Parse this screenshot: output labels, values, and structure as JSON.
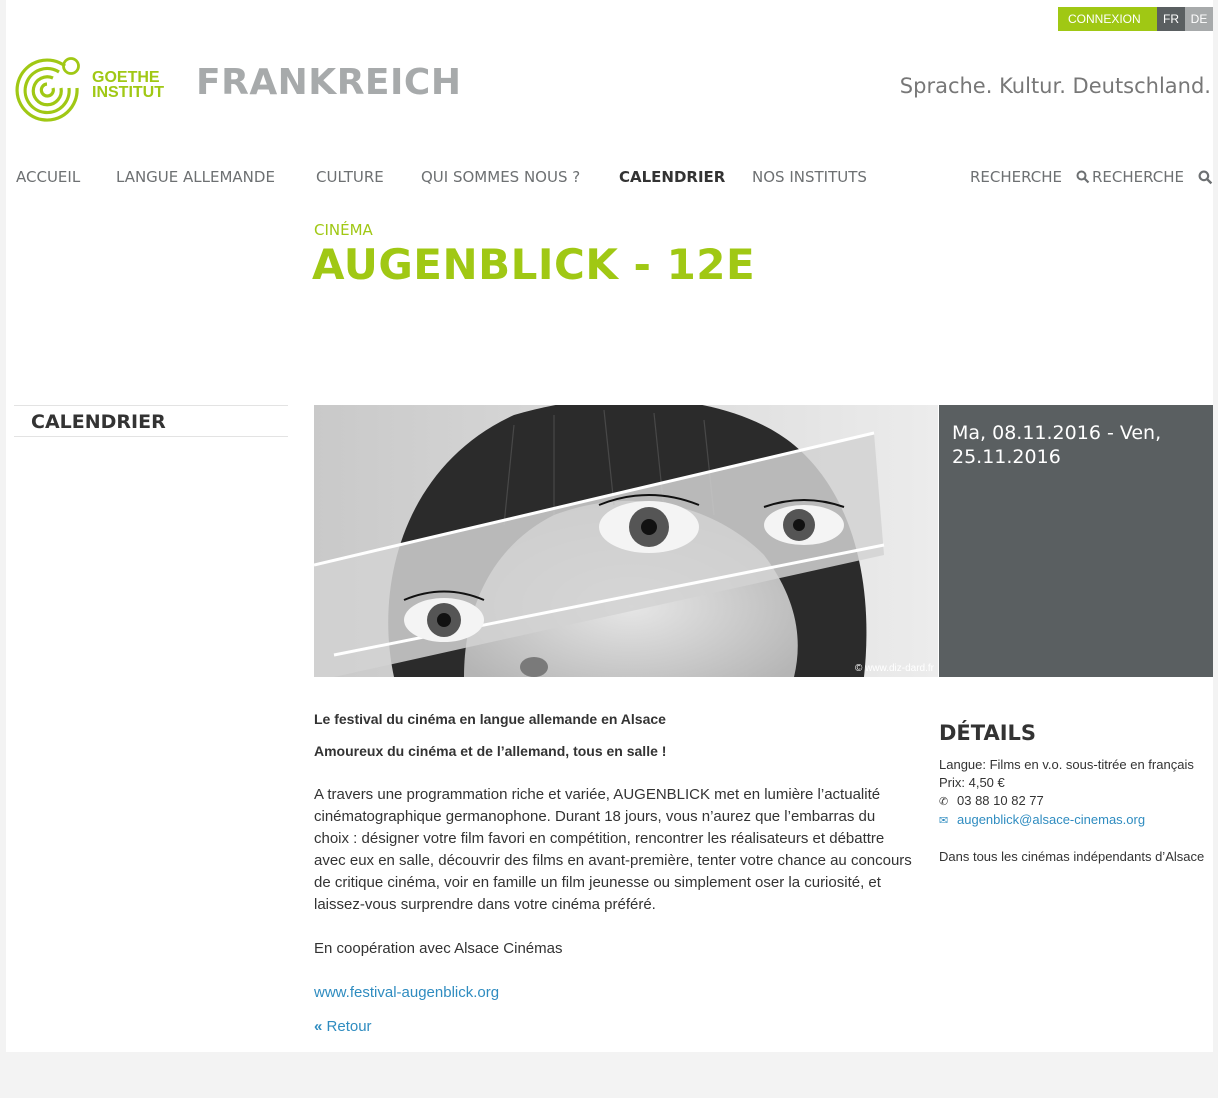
{
  "topbar": {
    "login_label": "CONNEXION ≫",
    "lang_fr": "FR",
    "lang_de": "DE"
  },
  "header": {
    "logo_line1": "GOETHE",
    "logo_line2": "INSTITUT",
    "site_title": "FRANKREICH",
    "tagline": "Sprache. Kultur. Deutschland."
  },
  "nav": {
    "items": [
      "ACCUEIL",
      "LANGUE ALLEMANDE",
      "CULTURE",
      "QUI SOMMES NOUS ?",
      "CALENDRIER",
      "NOS INSTITUTS"
    ],
    "search1": "RECHERCHE",
    "search2": "RECHERCHE"
  },
  "event": {
    "category": "CINÉMA",
    "title": "AUGENBLICK - 12E",
    "image_credit": "© www.diz-dard.fr",
    "dates": "Ma, 08.11.2016 - Ven, 25.11.2016"
  },
  "sidebar": {
    "title": "CALENDRIER"
  },
  "content": {
    "lead1": "Le festival du cinéma en langue allemande en Alsace",
    "lead2": "Amoureux du cinéma et de l’allemand, tous en salle !",
    "paragraph": "A travers une programmation riche et variée, AUGENBLICK met en lumière l’actualité cinématographique germanophone. Durant 18 jours, vous n’aurez que l’embarras du choix : désigner votre film favori en compétition, rencontrer les réalisateurs et débattre avec eux en salle, découvrir des films en avant-première, tenter votre chance au concours de critique cinéma, voir en famille un film jeunesse ou simplement oser la curiosité, et laissez-vous surprendre dans votre cinéma préféré.",
    "cooperation": "En coopération avec Alsace Cinémas",
    "website": "www.festival-augenblick.org",
    "back": "Retour"
  },
  "details": {
    "heading": "DÉTAILS",
    "language": "Langue: Films en v.o. sous-titrée en français",
    "price": "Prix: 4,50 €",
    "phone": "03 88 10 82 77",
    "email": "augenblick@alsace-cinemas.org",
    "location": "Dans tous les cinémas indépendants d’Alsace"
  },
  "colors": {
    "accent": "#a0c814",
    "date_bg": "#5a5f61",
    "link": "#2f8cc0"
  }
}
